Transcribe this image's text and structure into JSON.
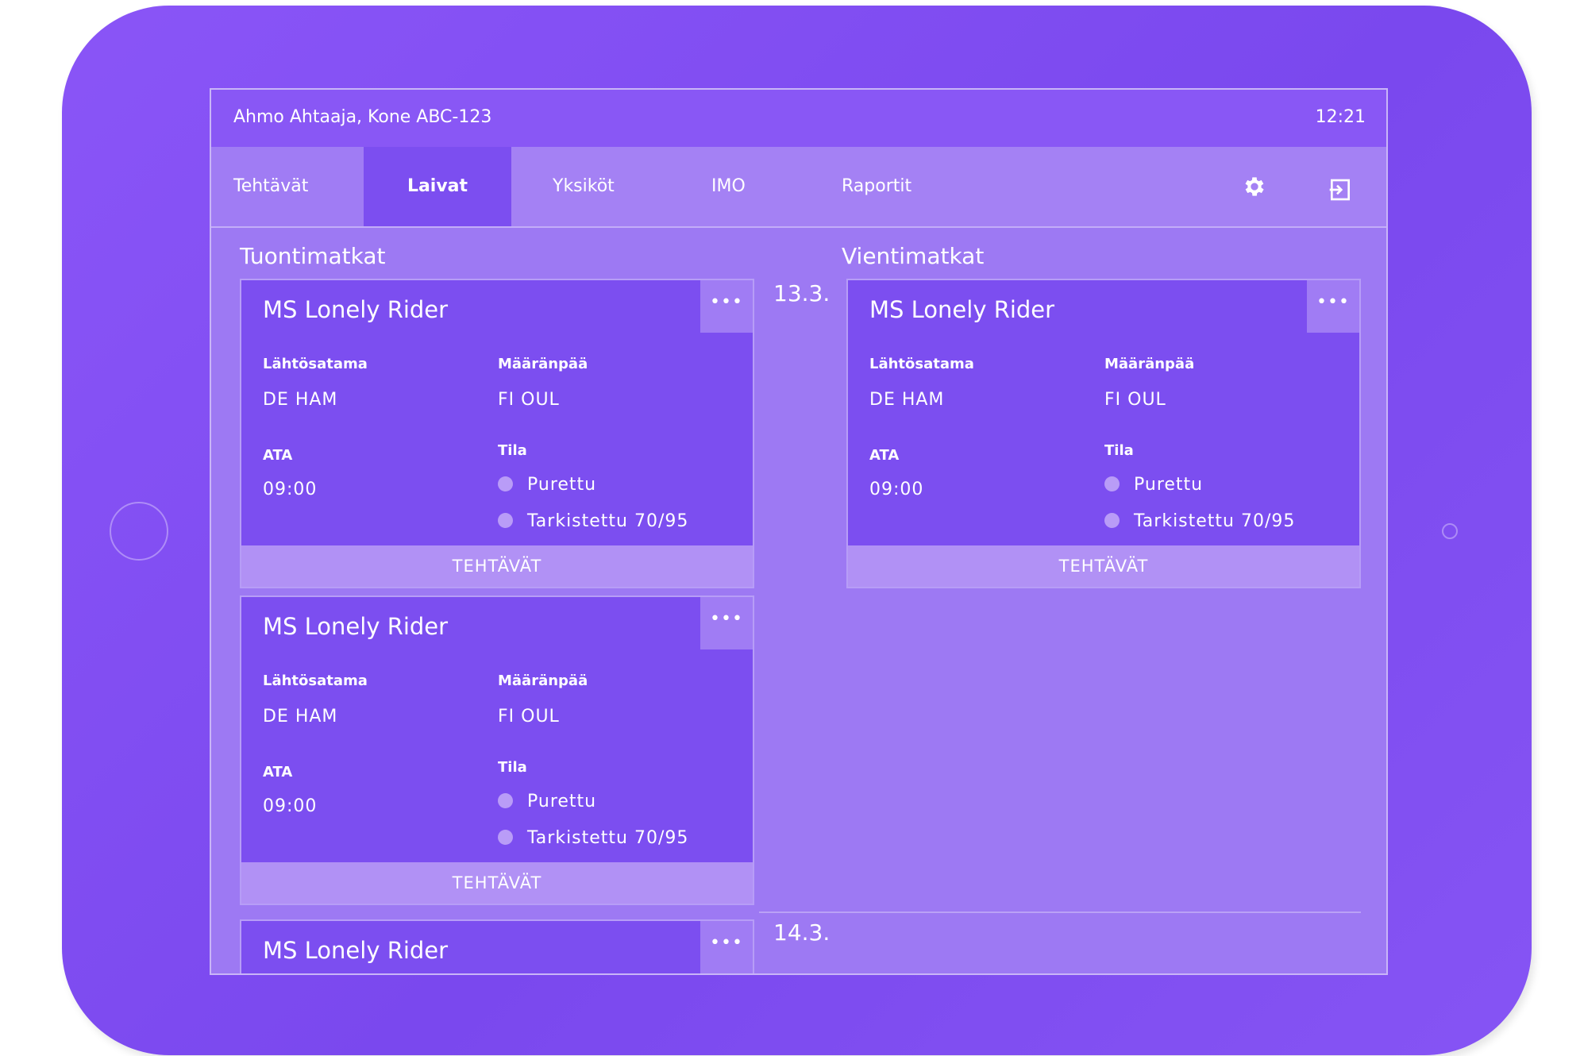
{
  "statusbar": {
    "user": "Ahmo Ahtaaja, Kone ABC-123",
    "time": "12:21"
  },
  "nav": {
    "tabs": [
      "Tehtävät",
      "Laivat",
      "Yksiköt",
      "IMO",
      "Raportit"
    ],
    "active": "Laivat",
    "icons": [
      "gear-icon",
      "logout-icon"
    ]
  },
  "columns": {
    "import_title": "Tuontimatkat",
    "export_title": "Vientimatkat"
  },
  "dates": [
    "13.3.",
    "14.3."
  ],
  "cards": [
    {
      "title": "MS Lonely Rider",
      "more": "•••",
      "departure_label": "Lähtösatama",
      "departure": "DE HAM",
      "destination_label": "Määränpää",
      "destination": "FI OUL",
      "ata_label": "ATA",
      "ata": "09:00",
      "status_label": "Tila",
      "status_1": "Purettu",
      "status_2": "Tarkistettu 70/95",
      "footer": "TEHTÄVÄT"
    },
    {
      "title": "MS Lonely Rider",
      "more": "•••",
      "departure_label": "Lähtösatama",
      "departure": "DE HAM",
      "destination_label": "Määränpää",
      "destination": "FI OUL",
      "ata_label": "ATA",
      "ata": "09:00",
      "status_label": "Tila",
      "status_1": "Purettu",
      "status_2": "Tarkistettu 70/95",
      "footer": "TEHTÄVÄT"
    },
    {
      "title": "MS Lonely Rider",
      "more": "•••",
      "departure_label": "Lähtösatama",
      "departure": "DE HAM",
      "destination_label": "Määränpää",
      "destination": "FI OUL",
      "ata_label": "ATA",
      "ata": "09:00",
      "status_label": "Tila",
      "status_1": "Purettu",
      "status_2": "Tarkistettu 70/95",
      "footer": "TEHTÄVÄT"
    },
    {
      "title": "MS Lonely Rider",
      "more": "•••"
    }
  ]
}
